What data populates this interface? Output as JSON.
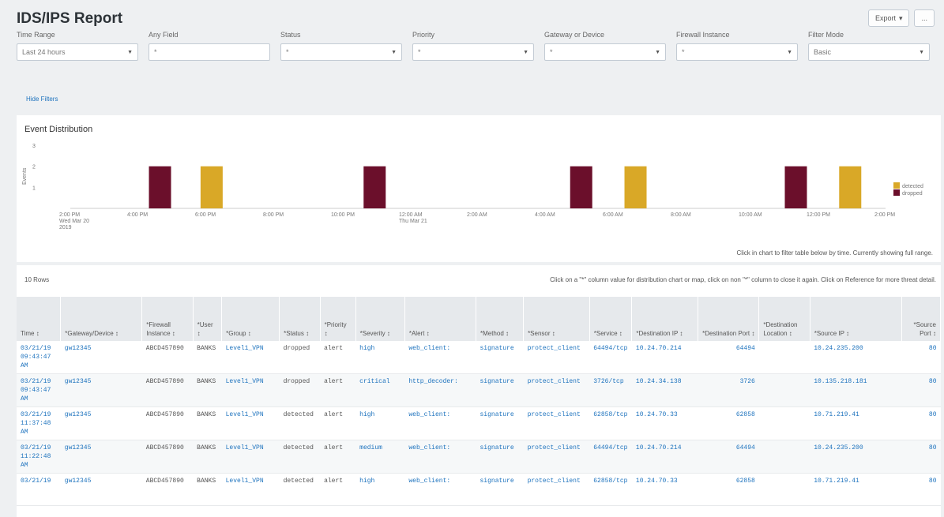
{
  "header": {
    "title": "IDS/IPS Report",
    "export_label": "Export",
    "more_label": "..."
  },
  "filters": [
    {
      "label": "Time Range",
      "value": "Last 24 hours",
      "type": "select"
    },
    {
      "label": "Any Field",
      "value": "*",
      "type": "input"
    },
    {
      "label": "Status",
      "value": "*",
      "type": "select"
    },
    {
      "label": "Priority",
      "value": "*",
      "type": "select"
    },
    {
      "label": "Gateway or Device",
      "value": "*",
      "type": "select"
    },
    {
      "label": "Firewall Instance",
      "value": "*",
      "type": "select"
    },
    {
      "label": "Filter Mode",
      "value": "Basic",
      "type": "select"
    }
  ],
  "hide_filters_label": "Hide Filters",
  "chart_panel": {
    "title": "Event Distribution",
    "note": "Click in chart to filter table below by time. Currently showing full range."
  },
  "chart_data": {
    "type": "bar",
    "ylabel": "Events",
    "yticks": [
      "1",
      "2",
      "3"
    ],
    "ylim": [
      0,
      3
    ],
    "x_ticks": [
      {
        "label": "2:00 PM",
        "sub": "Wed Mar 20",
        "sub2": "2019"
      },
      {
        "label": "4:00 PM"
      },
      {
        "label": "6:00 PM"
      },
      {
        "label": "8:00 PM"
      },
      {
        "label": "10:00 PM"
      },
      {
        "label": "12:00 AM",
        "sub": "Thu Mar 21"
      },
      {
        "label": "2:00 AM"
      },
      {
        "label": "4:00 AM"
      },
      {
        "label": "6:00 AM"
      },
      {
        "label": "8:00 AM"
      },
      {
        "label": "10:00 AM"
      },
      {
        "label": "12:00 PM"
      },
      {
        "label": "2:00 PM"
      }
    ],
    "series": [
      {
        "name": "detected",
        "color": "#d9a827",
        "points": [
          {
            "x": 5.2,
            "y": 2
          },
          {
            "x": 20.8,
            "y": 2
          },
          {
            "x": 28.7,
            "y": 2
          }
        ]
      },
      {
        "name": "dropped",
        "color": "#6b0f2b",
        "points": [
          {
            "x": 3.3,
            "y": 2
          },
          {
            "x": 11.2,
            "y": 2
          },
          {
            "x": 18.8,
            "y": 2
          },
          {
            "x": 26.7,
            "y": 2
          }
        ]
      }
    ],
    "legend": "right"
  },
  "table_panel": {
    "rows_label": "10 Rows",
    "hint": "Click on a \"*\" column value for distribution chart or map, click on non \"*\" column to close it again. Click on Reference for more threat detail."
  },
  "columns": [
    {
      "label": "Time ↕",
      "align": "left"
    },
    {
      "label": "*Gateway/Device ↕",
      "align": "left"
    },
    {
      "label": "*Firewall Instance ↕",
      "align": "left"
    },
    {
      "label": "*User ↕",
      "align": "left"
    },
    {
      "label": "*Group ↕",
      "align": "left"
    },
    {
      "label": "*Status ↕",
      "align": "left"
    },
    {
      "label": "*Priority ↕",
      "align": "left"
    },
    {
      "label": "*Severity ↕",
      "align": "left"
    },
    {
      "label": "*Alert ↕",
      "align": "left"
    },
    {
      "label": "*Method ↕",
      "align": "left"
    },
    {
      "label": "*Sensor ↕",
      "align": "left"
    },
    {
      "label": "*Service ↕",
      "align": "left"
    },
    {
      "label": "*Destination IP ↕",
      "align": "left"
    },
    {
      "label": "*Destination Port ↕",
      "align": "right"
    },
    {
      "label": "*Destination Location ↕",
      "align": "left"
    },
    {
      "label": "*Source IP ↕",
      "align": "left"
    },
    {
      "label": "*Source Port ↕",
      "align": "right"
    }
  ],
  "rows": [
    [
      "03/21/19 09:43:47 AM",
      "gw12345",
      "ABCD457890",
      "BANKS",
      "Level1_VPN",
      "dropped",
      "alert",
      "high",
      "web_client:",
      "signature",
      "protect_client",
      "64494/tcp",
      "10.24.70.214",
      "64494",
      "",
      "10.24.235.200",
      "80"
    ],
    [
      "03/21/19 09:43:47 AM",
      "gw12345",
      "ABCD457890",
      "BANKS",
      "Level1_VPN",
      "dropped",
      "alert",
      "critical",
      "http_decoder:",
      "signature",
      "protect_client",
      "3726/tcp",
      "10.24.34.138",
      "3726",
      "",
      "10.135.218.181",
      "80"
    ],
    [
      "03/21/19 11:37:48 AM",
      "gw12345",
      "ABCD457890",
      "BANKS",
      "Level1_VPN",
      "detected",
      "alert",
      "high",
      "web_client:",
      "signature",
      "protect_client",
      "62858/tcp",
      "10.24.70.33",
      "62858",
      "",
      "10.71.219.41",
      "80"
    ],
    [
      "03/21/19 11:22:48 AM",
      "gw12345",
      "ABCD457890",
      "BANKS",
      "Level1_VPN",
      "detected",
      "alert",
      "medium",
      "web_client:",
      "signature",
      "protect_client",
      "64494/tcp",
      "10.24.70.214",
      "64494",
      "",
      "10.24.235.200",
      "80"
    ],
    [
      "03/21/19",
      "gw12345",
      "ABCD457890",
      "BANKS",
      "Level1_VPN",
      "detected",
      "alert",
      "high",
      "web_client:",
      "signature",
      "protect_client",
      "62858/tcp",
      "10.24.70.33",
      "62858",
      "",
      "10.71.219.41",
      "80"
    ]
  ]
}
